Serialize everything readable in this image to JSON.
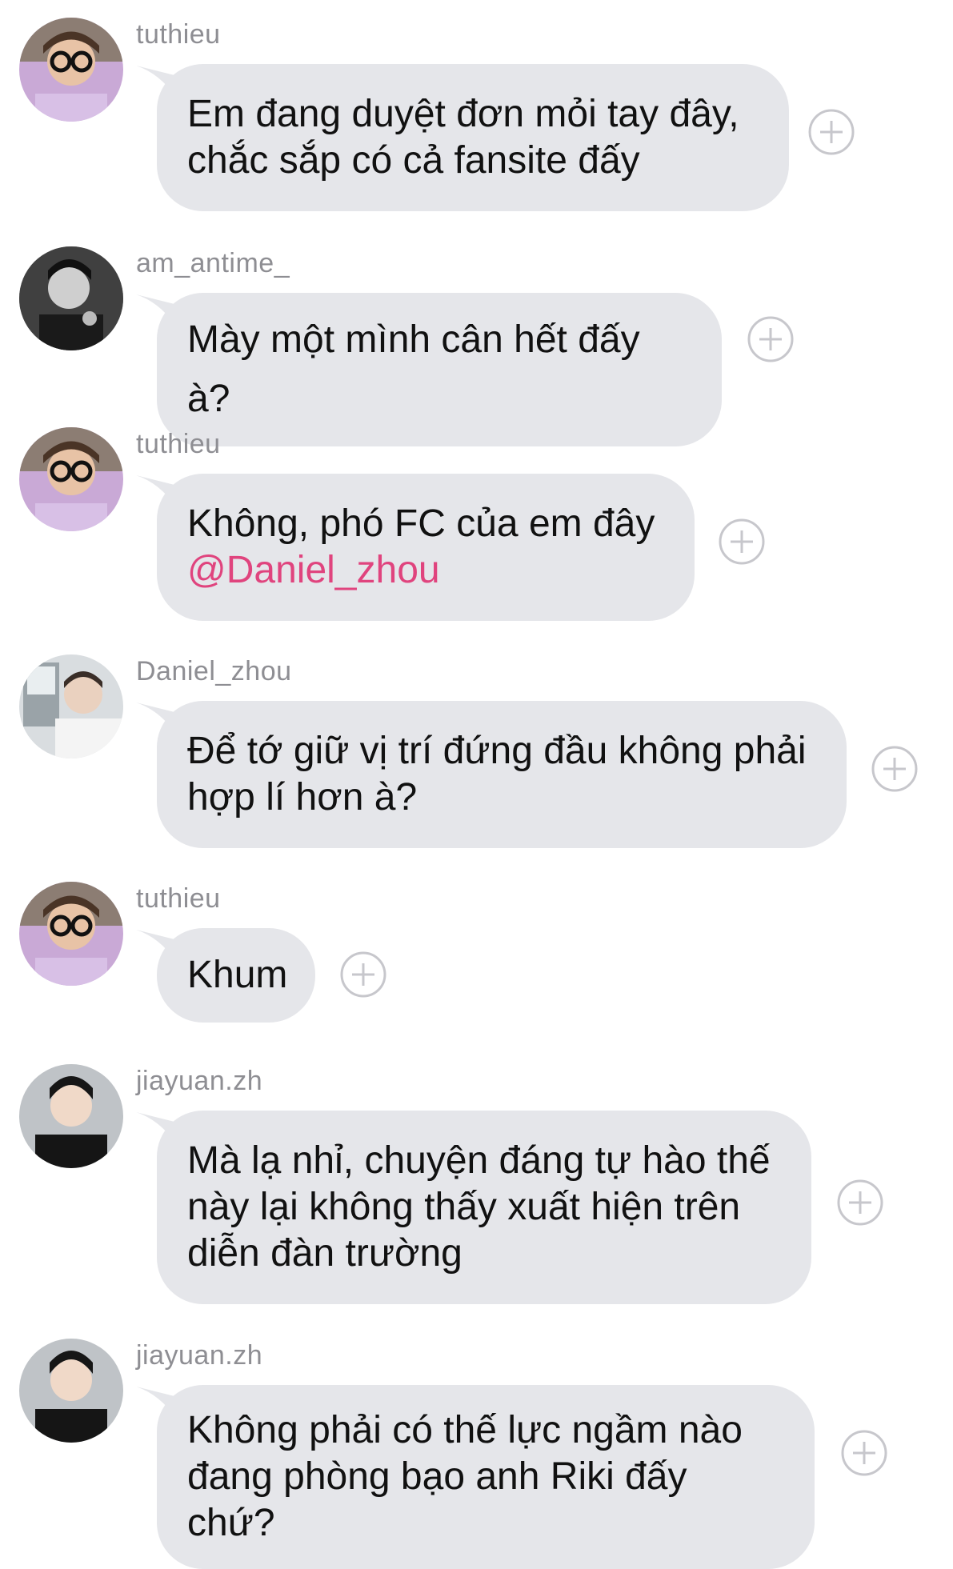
{
  "messages": [
    {
      "username": "tuthieu",
      "avatar_icon": "avatar-glasses-icon",
      "lines": [
        "Em đang duyệt đơn mỏi tay đây,",
        "chắc sắp có cả fansite đấy"
      ]
    },
    {
      "username": "am_antime_",
      "avatar_icon": "avatar-bw-portrait-icon",
      "lines": [
        "Mày một mình cân hết đấy à?"
      ]
    },
    {
      "username": "tuthieu",
      "avatar_icon": "avatar-glasses-icon",
      "lines": [
        "Không, phó FC của em đây"
      ],
      "mention": "@Daniel_zhou"
    },
    {
      "username": "Daniel_zhou",
      "avatar_icon": "avatar-window-portrait-icon",
      "lines": [
        "Để tớ giữ vị trí đứng đầu không phải",
        "hợp lí hơn à?"
      ]
    },
    {
      "username": "tuthieu",
      "avatar_icon": "avatar-glasses-icon",
      "lines": [
        "Khum"
      ]
    },
    {
      "username": "jiayuan.zh",
      "avatar_icon": "avatar-dark-portrait-icon",
      "lines": [
        "Mà lạ nhỉ, chuyện đáng tự hào thế",
        "này lại không thấy xuất hiện trên",
        "diễn đàn trường"
      ]
    },
    {
      "username": "jiayuan.zh",
      "avatar_icon": "avatar-dark-portrait-icon",
      "lines": [
        "Không phải có thế lực ngầm nào",
        "đang phòng bạo anh Riki đấy chứ?"
      ]
    }
  ],
  "colors": {
    "bubble": "#e5e6ea",
    "mention": "#e0447e",
    "username": "#8e8e93",
    "plus": "#c7c7cc"
  },
  "icons": {
    "react": "plus-circle-icon"
  }
}
